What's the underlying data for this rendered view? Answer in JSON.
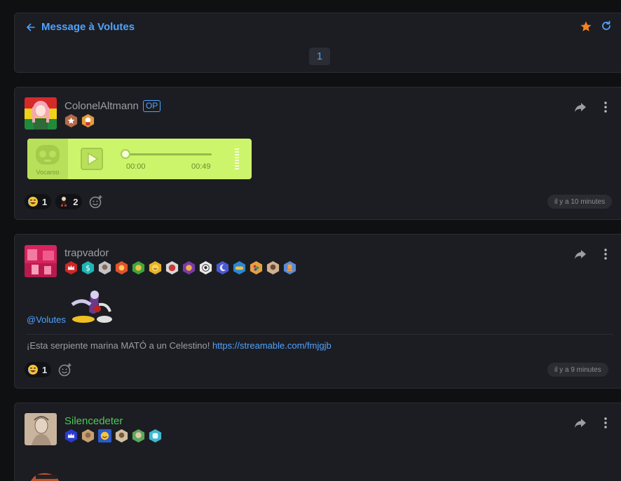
{
  "header": {
    "title": "Message à Volutes",
    "page_number": "1",
    "star_color": "#f5831f",
    "accent_color": "#4ea3ff"
  },
  "posts": [
    {
      "username": "ColonelAltmann",
      "op_badge": "OP",
      "audio": {
        "service": "Vocaroo",
        "current_time": "00:00",
        "duration": "00:49",
        "progress": 0
      },
      "reactions": [
        {
          "emoji": "crying-laugh-emoji",
          "count": "1"
        },
        {
          "emoji": "dancing-emoji",
          "count": "2"
        }
      ],
      "time": "il y a 10 minutes"
    },
    {
      "username": "trapvador",
      "mention": "@Volutes",
      "text": "¡Esta serpiente marina MATÓ a un Celestino! ",
      "link": "https://streamable.com/fmjgjb",
      "reactions": [
        {
          "emoji": "crying-laugh-emoji",
          "count": "1"
        }
      ],
      "time": "il y a 9 minutes"
    },
    {
      "username": "Silencedeter",
      "username_color": "#4cc85a"
    }
  ]
}
